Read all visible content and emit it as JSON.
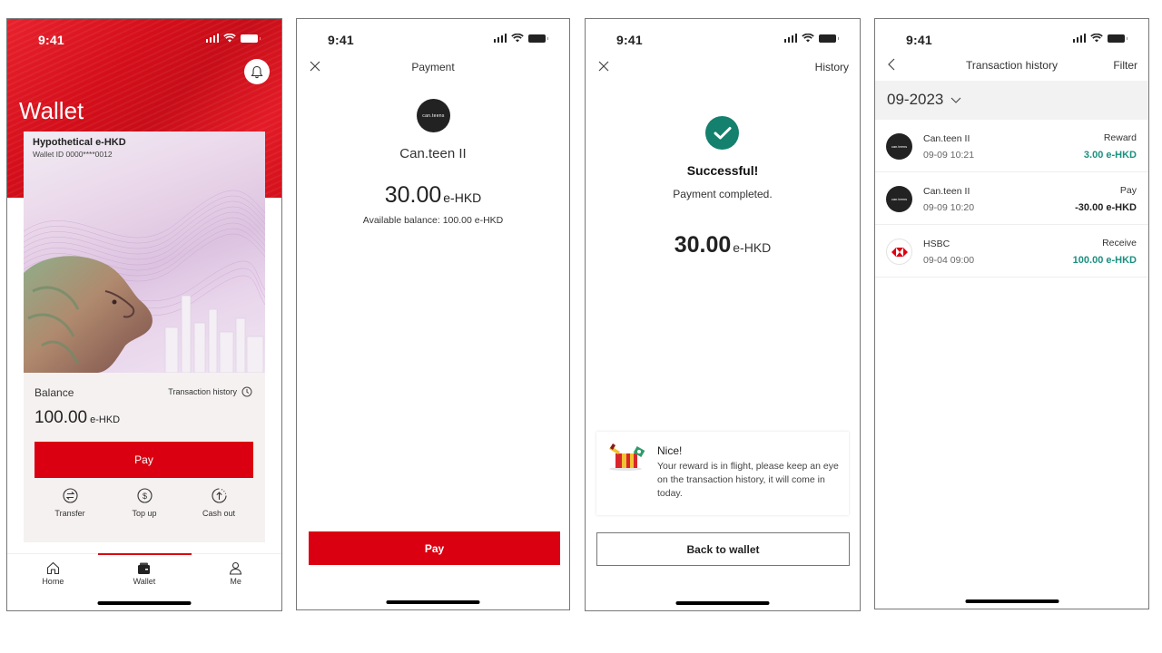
{
  "status_bar": {
    "time": "9:41"
  },
  "colors": {
    "brand_red": "#db0011",
    "success_green": "#14806e",
    "credit_teal": "#1a9080",
    "debit_dark": "#222222"
  },
  "wallet_screen": {
    "title": "Wallet",
    "notification_icon": "bell-icon",
    "card": {
      "name": "Hypothetical e-HKD",
      "wallet_id": "Wallet ID 0000****0012"
    },
    "balance_label": "Balance",
    "transaction_history_link": "Transaction history",
    "balance_amount": "100.00",
    "balance_unit": "e-HKD",
    "pay_button": "Pay",
    "actions": [
      {
        "label": "Transfer",
        "icon": "transfer-icon"
      },
      {
        "label": "Top up",
        "icon": "dollar-icon"
      },
      {
        "label": "Cash out",
        "icon": "cash-out-icon"
      }
    ],
    "tabs": [
      {
        "label": "Home",
        "icon": "home-icon",
        "active": false
      },
      {
        "label": "Wallet",
        "icon": "wallet-icon",
        "active": true
      },
      {
        "label": "Me",
        "icon": "user-icon",
        "active": false
      }
    ]
  },
  "payment_screen": {
    "title": "Payment",
    "merchant_logo_text": "can.teens",
    "merchant_name": "Can.teen II",
    "amount": "30.00",
    "unit": "e-HKD",
    "available_balance": "Available balance: 100.00 e-HKD",
    "pay_button": "Pay"
  },
  "success_screen": {
    "history_link": "History",
    "title": "Successful!",
    "subtitle": "Payment completed.",
    "amount": "30.00",
    "unit": "e-HKD",
    "reward_title": "Nice!",
    "reward_text": "Your reward is in flight, please keep an eye on the transaction history, it will come in today.",
    "back_button": "Back to wallet"
  },
  "history_screen": {
    "title": "Transaction history",
    "filter": "Filter",
    "month": "09-2023",
    "transactions": [
      {
        "merchant": "Can.teen II",
        "logo": "can.teens",
        "datetime": "09-09 10:21",
        "type": "Reward",
        "amount": "3.00 e-HKD",
        "direction": "credit"
      },
      {
        "merchant": "Can.teen II",
        "logo": "can.teens",
        "datetime": "09-09 10:20",
        "type": "Pay",
        "amount": "-30.00 e-HKD",
        "direction": "debit"
      },
      {
        "merchant": "HSBC",
        "logo": "hsbc",
        "datetime": "09-04 09:00",
        "type": "Receive",
        "amount": "100.00 e-HKD",
        "direction": "credit"
      }
    ]
  }
}
